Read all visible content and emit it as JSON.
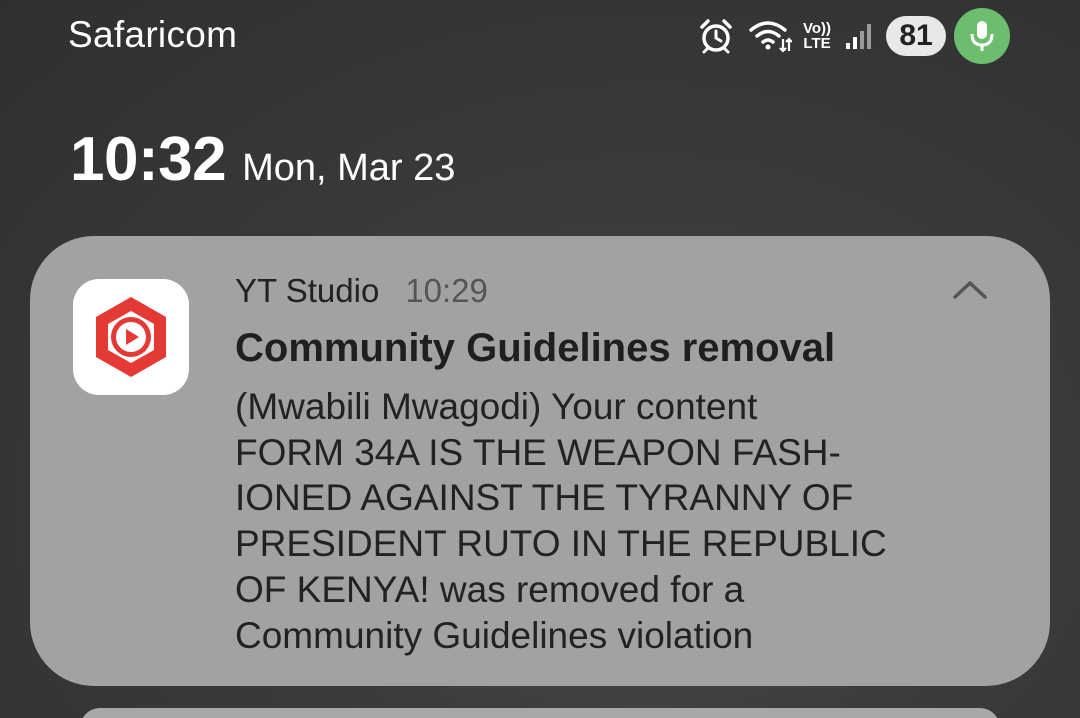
{
  "status_bar": {
    "carrier": "Safaricom",
    "volte_top": "Vo))",
    "volte_bottom": "LTE",
    "battery_level": "81",
    "icons": [
      "alarm-icon",
      "wifi-icon",
      "volte-icon",
      "signal-icon",
      "battery-icon",
      "mic-icon"
    ]
  },
  "lock": {
    "time": "10:32",
    "date": "Mon, Mar 23"
  },
  "notification": {
    "app_name": "YT Studio",
    "time": "10:29",
    "title": "Community Guidelines removal",
    "body_lines": [
      "(Mwabili Mwagodi) Your content",
      "FORM 34A IS THE WEAPON FASH-",
      "IONED AGAINST THE TYRANNY OF",
      "PRESIDENT RUTO IN THE REPUBLIC",
      "OF KENYA! was removed for a",
      "Community Guidelines violation"
    ],
    "icon": "yt-studio-icon",
    "accent": "#e53935"
  },
  "colors": {
    "mic_active": "#6dbd6f",
    "card_bg": "#a2a2a2"
  }
}
